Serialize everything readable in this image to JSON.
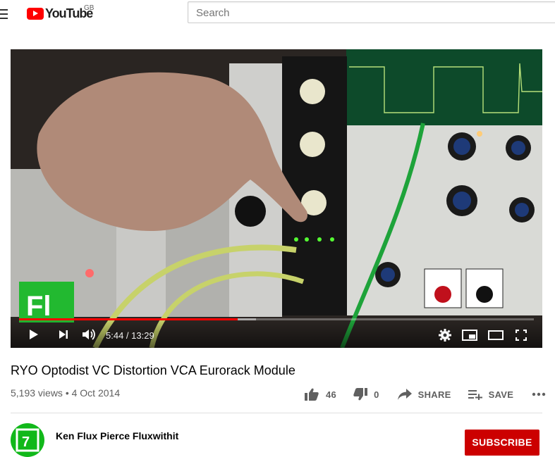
{
  "header": {
    "logo_text": "YouTube",
    "region": "GB",
    "search_placeholder": "Search"
  },
  "player": {
    "current_time": "5:44",
    "duration": "13:29",
    "time_display": "5:44 / 13:29",
    "progress_fraction": 0.425,
    "buffer_fraction": 0.46
  },
  "video": {
    "title": "RYO Optodist VC Distortion VCA Eurorack Module",
    "views": "5,193 views",
    "separator": "•",
    "date": "4 Oct 2014",
    "meta_text": "5,193 views • 4 Oct 2014"
  },
  "actions": {
    "likes": "46",
    "dislikes": "0",
    "share_label": "SHARE",
    "save_label": "SAVE"
  },
  "channel": {
    "name": "Ken Flux Pierce Fluxwithit",
    "subscribe_label": "SUBSCRIBE"
  },
  "colors": {
    "brand_red": "#ff0000",
    "subscribe_red": "#cc0000",
    "avatar_green": "#11b81a",
    "text_secondary": "#606060"
  }
}
